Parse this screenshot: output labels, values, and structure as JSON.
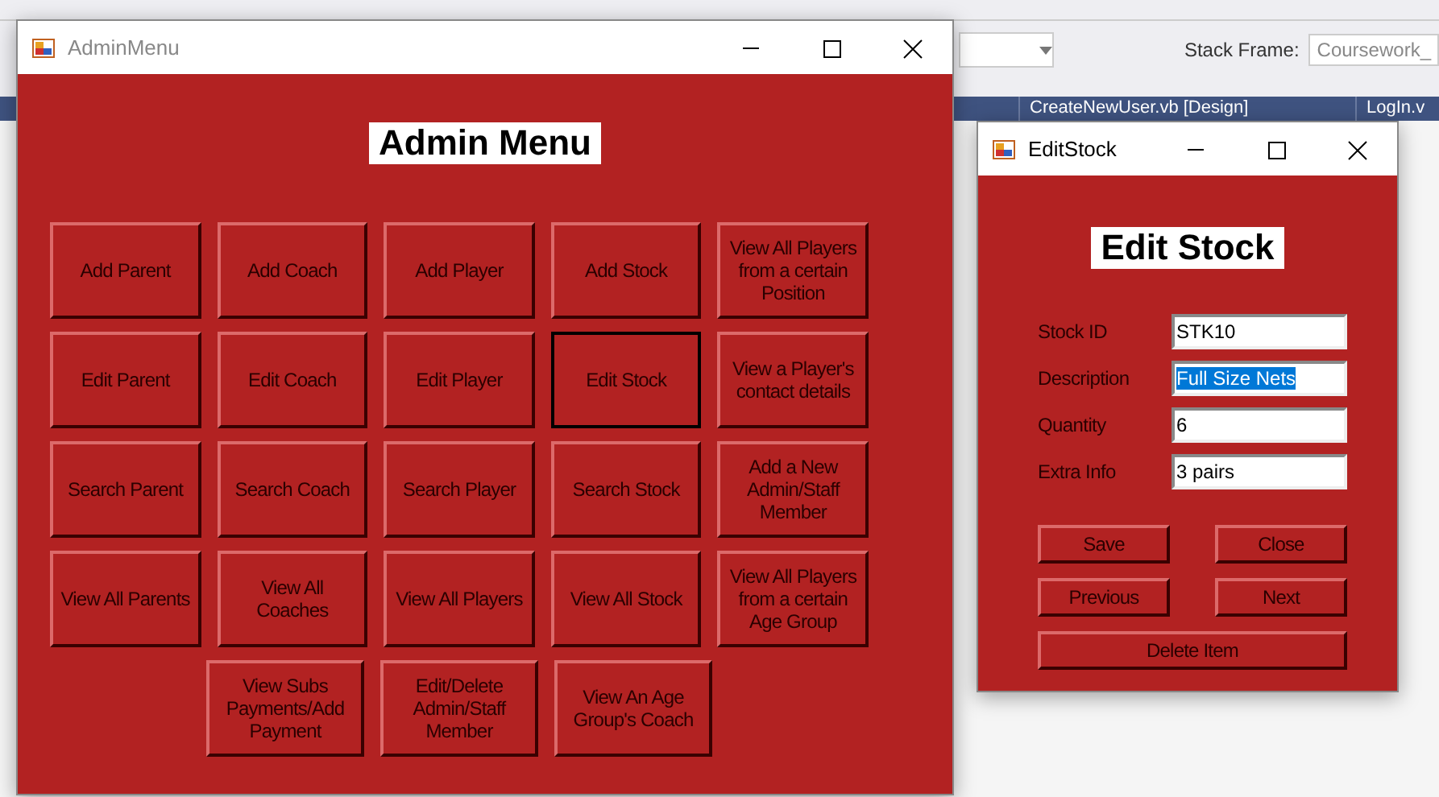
{
  "ide": {
    "stack_frame_label": "Stack Frame:",
    "stack_frame_value": "Coursework_",
    "tabs": [
      {
        "label": "CreateNewUser.vb [Design]",
        "selected": false
      },
      {
        "label": "LogIn.v",
        "selected": false
      }
    ]
  },
  "admin_window": {
    "title": "AdminMenu",
    "active": false,
    "heading": "Admin Menu",
    "button_rows": [
      [
        {
          "label": "Add Parent",
          "focused": false
        },
        {
          "label": "Add Coach",
          "focused": false
        },
        {
          "label": "Add Player",
          "focused": false
        },
        {
          "label": "Add Stock",
          "focused": false
        },
        {
          "label": "View All Players from a certain Position",
          "focused": false
        }
      ],
      [
        {
          "label": "Edit Parent",
          "focused": false
        },
        {
          "label": "Edit Coach",
          "focused": false
        },
        {
          "label": "Edit Player",
          "focused": false
        },
        {
          "label": "Edit Stock",
          "focused": true
        },
        {
          "label": "View a Player's contact details",
          "focused": false
        }
      ],
      [
        {
          "label": "Search Parent",
          "focused": false
        },
        {
          "label": "Search Coach",
          "focused": false
        },
        {
          "label": "Search Player",
          "focused": false
        },
        {
          "label": "Search Stock",
          "focused": false
        },
        {
          "label": "Add a New Admin/Staff Member",
          "focused": false
        }
      ],
      [
        {
          "label": "View All Parents",
          "focused": false
        },
        {
          "label": "View All Coaches",
          "focused": false
        },
        {
          "label": "View All Players",
          "focused": false
        },
        {
          "label": "View All Stock",
          "focused": false
        },
        {
          "label": "View All Players from a certain Age Group",
          "focused": false
        }
      ],
      [
        {
          "label": "View Subs Payments/Add Payment",
          "focused": false
        },
        {
          "label": "Edit/Delete Admin/Staff Member",
          "focused": false
        },
        {
          "label": "View An Age Group's Coach",
          "focused": false
        }
      ]
    ]
  },
  "edit_window": {
    "title": "EditStock",
    "active": true,
    "heading": "Edit Stock",
    "fields": [
      {
        "label": "Stock ID",
        "value": "STK10",
        "highlighted": false
      },
      {
        "label": "Description",
        "value": "Full Size Nets",
        "highlighted": true
      },
      {
        "label": "Quantity",
        "value": "6",
        "highlighted": false
      },
      {
        "label": "Extra Info",
        "value": "3 pairs",
        "highlighted": false
      }
    ],
    "buttons": [
      {
        "label": "Save",
        "wide": false
      },
      {
        "label": "Close",
        "wide": false
      },
      {
        "label": "Previous",
        "wide": false
      },
      {
        "label": "Next",
        "wide": false
      },
      {
        "label": "Delete Item",
        "wide": true
      }
    ]
  }
}
